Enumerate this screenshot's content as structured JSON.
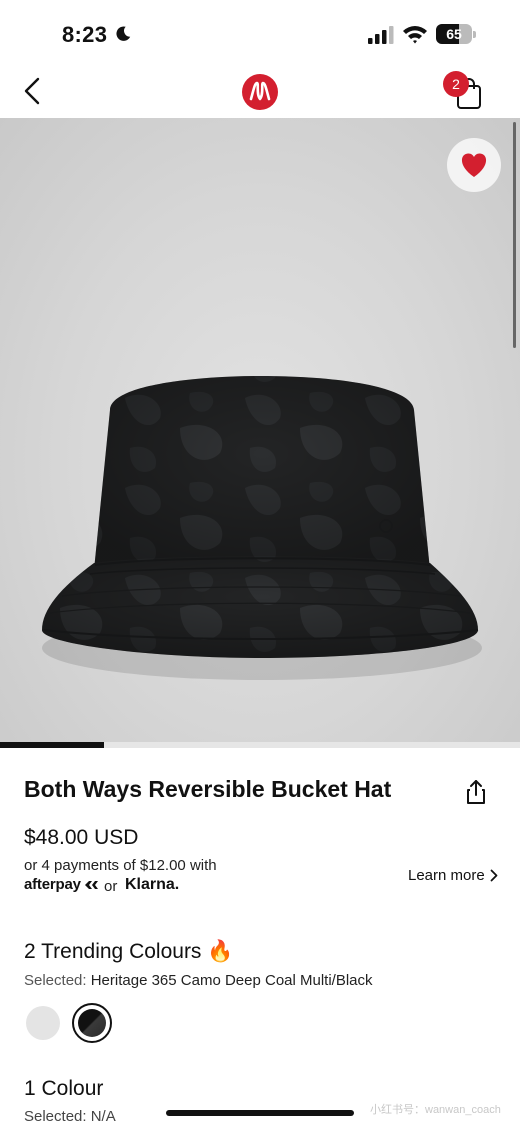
{
  "status_bar": {
    "time": "8:23",
    "battery": "65",
    "battery_fraction": 0.65
  },
  "nav": {
    "bag_count": "2",
    "icons": {
      "back": "chevron-left-icon",
      "logo": "lululemon-logo",
      "bag": "shopping-bag-icon"
    }
  },
  "gallery": {
    "progress_fraction": 0.2,
    "favorite_icon": "heart-icon",
    "favorite_color": "#d31f2f"
  },
  "product": {
    "title": "Both Ways Reversible Bucket Hat",
    "price": "$48.00 USD",
    "installments": "or 4 payments of $12.00 with",
    "afterpay": "afterpay",
    "or": "or",
    "klarna": "Klarna.",
    "learn_more": "Learn more"
  },
  "colours": {
    "heading": "2 Trending Colours 🔥",
    "selected_label": "Selected:",
    "selected_value": "Heritage 365 Camo Deep Coal Multi/Black",
    "swatches": [
      "#e4e4e4",
      "#111111"
    ]
  },
  "colours2": {
    "heading": "1 Colour",
    "selected_label": "Selected:",
    "selected_value": "N/A"
  },
  "watermark": "小红书号：wanwan_coach"
}
